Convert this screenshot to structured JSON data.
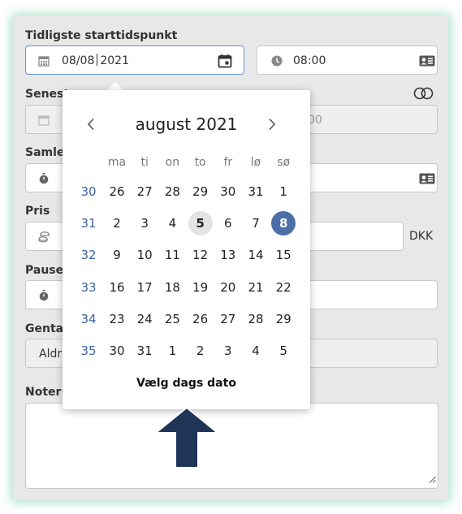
{
  "form": {
    "earliest_start": {
      "label": "Tidligste starttidspunkt",
      "date_value_before": "08/08",
      "date_value_after": "2021",
      "time_value": "08:00"
    },
    "latest_start": {
      "label": "Senest",
      "time_value": "00"
    },
    "total": {
      "label": "Samle"
    },
    "price": {
      "label": "Pris",
      "currency": "DKK"
    },
    "pause": {
      "label": "Pause"
    },
    "repeat": {
      "label": "Gentag",
      "value": "Aldr"
    },
    "notes": {
      "label": "Noter"
    }
  },
  "datepicker": {
    "month_title": "august 2021",
    "weekdays": [
      "ma",
      "ti",
      "on",
      "to",
      "fr",
      "lø",
      "sø"
    ],
    "weeks": [
      {
        "week": "30",
        "days": [
          "26",
          "27",
          "28",
          "29",
          "30",
          "31",
          "1"
        ]
      },
      {
        "week": "31",
        "days": [
          "2",
          "3",
          "4",
          "5",
          "6",
          "7",
          "8"
        ]
      },
      {
        "week": "32",
        "days": [
          "9",
          "10",
          "11",
          "12",
          "13",
          "14",
          "15"
        ]
      },
      {
        "week": "33",
        "days": [
          "16",
          "17",
          "18",
          "19",
          "20",
          "21",
          "22"
        ]
      },
      {
        "week": "34",
        "days": [
          "23",
          "24",
          "25",
          "26",
          "27",
          "28",
          "29"
        ]
      },
      {
        "week": "35",
        "days": [
          "30",
          "31",
          "1",
          "2",
          "3",
          "4",
          "5"
        ]
      }
    ],
    "today_day": "5",
    "selected_day": "8",
    "today_button": "Vælg dags dato"
  },
  "colors": {
    "accent": "#4d6fa8",
    "week_number": "#3d64a8",
    "arrow": "#1f3557",
    "frame_glow": "#aae1cd"
  }
}
